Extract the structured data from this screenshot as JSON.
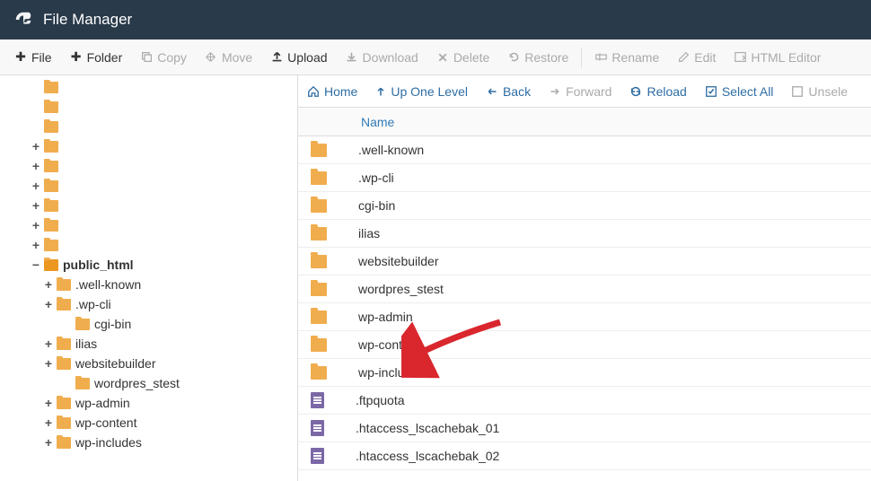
{
  "header": {
    "title": "File Manager"
  },
  "toolbar": {
    "file": "File",
    "folder": "Folder",
    "copy": "Copy",
    "move": "Move",
    "upload": "Upload",
    "download": "Download",
    "delete": "Delete",
    "restore": "Restore",
    "rename": "Rename",
    "edit": "Edit",
    "htmleditor": "HTML Editor"
  },
  "navbar": {
    "home": "Home",
    "up": "Up One Level",
    "back": "Back",
    "forward": "Forward",
    "reload": "Reload",
    "selectall": "Select All",
    "unselect": "Unsele"
  },
  "tableHeader": {
    "name": "Name"
  },
  "tree": [
    {
      "level": 1,
      "toggle": "",
      "label": ""
    },
    {
      "level": 1,
      "toggle": "",
      "label": ""
    },
    {
      "level": 1,
      "toggle": "",
      "label": ""
    },
    {
      "level": 1,
      "toggle": "+",
      "label": ""
    },
    {
      "level": 1,
      "toggle": "+",
      "label": ""
    },
    {
      "level": 1,
      "toggle": "+",
      "label": ""
    },
    {
      "level": 1,
      "toggle": "+",
      "label": ""
    },
    {
      "level": 1,
      "toggle": "+",
      "label": ""
    },
    {
      "level": 1,
      "toggle": "+",
      "label": ""
    },
    {
      "level": 1,
      "toggle": "−",
      "label": "public_html",
      "bold": true,
      "open": true
    },
    {
      "level": 2,
      "toggle": "+",
      "label": ".well-known"
    },
    {
      "level": 2,
      "toggle": "+",
      "label": ".wp-cli"
    },
    {
      "level": 3,
      "toggle": "",
      "label": "cgi-bin"
    },
    {
      "level": 2,
      "toggle": "+",
      "label": "ilias"
    },
    {
      "level": 2,
      "toggle": "+",
      "label": "websitebuilder"
    },
    {
      "level": 3,
      "toggle": "",
      "label": "wordpres_stest"
    },
    {
      "level": 2,
      "toggle": "+",
      "label": "wp-admin"
    },
    {
      "level": 2,
      "toggle": "+",
      "label": "wp-content"
    },
    {
      "level": 2,
      "toggle": "+",
      "label": "wp-includes"
    }
  ],
  "files": [
    {
      "type": "folder",
      "name": ".well-known"
    },
    {
      "type": "folder",
      "name": ".wp-cli"
    },
    {
      "type": "folder",
      "name": "cgi-bin"
    },
    {
      "type": "folder",
      "name": "ilias"
    },
    {
      "type": "folder",
      "name": "websitebuilder"
    },
    {
      "type": "folder",
      "name": "wordpres_stest"
    },
    {
      "type": "folder",
      "name": "wp-admin"
    },
    {
      "type": "folder",
      "name": "wp-content"
    },
    {
      "type": "folder",
      "name": "wp-includes"
    },
    {
      "type": "file",
      "name": ".ftpquota"
    },
    {
      "type": "file",
      "name": ".htaccess_lscachebak_01"
    },
    {
      "type": "file",
      "name": ".htaccess_lscachebak_02"
    }
  ]
}
